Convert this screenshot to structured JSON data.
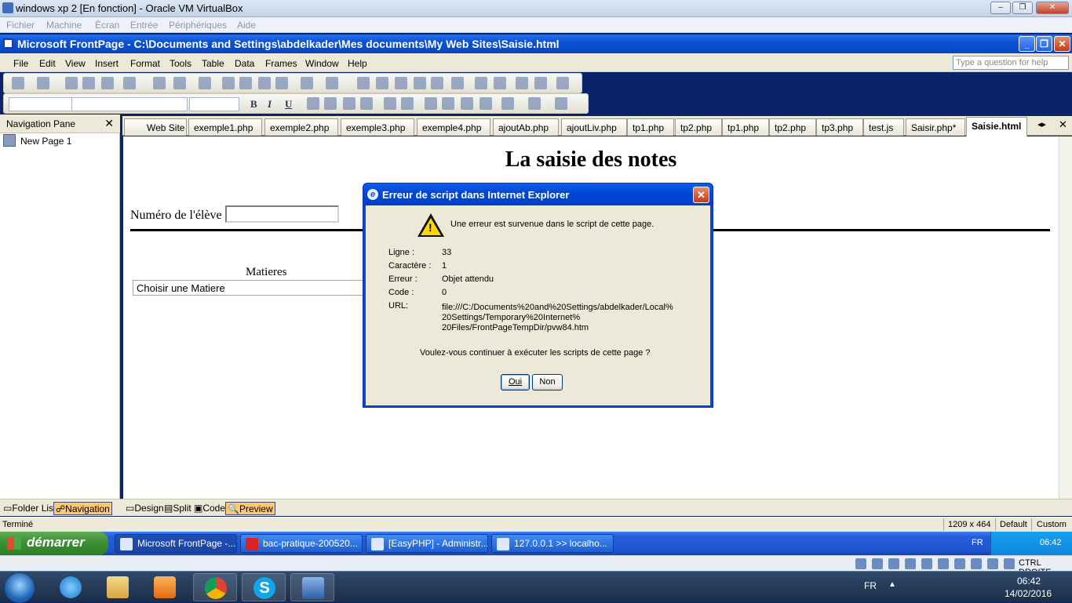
{
  "vbox": {
    "title": "windows xp 2 [En fonction] - Oracle VM VirtualBox",
    "menu": [
      "Fichier",
      "Machine",
      "Écran",
      "Entrée",
      "Périphériques",
      "Aide"
    ],
    "status_right": "CTRL DROITE"
  },
  "frontpage": {
    "title": "Microsoft FrontPage - C:\\Documents and Settings\\abdelkader\\Mes documents\\My Web Sites\\Saisie.html",
    "menu": [
      "File",
      "Edit",
      "View",
      "Insert",
      "Format",
      "Tools",
      "Table",
      "Data",
      "Frames",
      "Window",
      "Help"
    ],
    "help_placeholder": "Type a question for help",
    "nav_pane": {
      "title": "Navigation Pane",
      "close": "✕",
      "item": "New Page 1"
    },
    "tabs": [
      "Web Site",
      "exemple1.php",
      "exemple2.php",
      "exemple3.php",
      "exemple4.php",
      "ajoutAb.php",
      "ajoutLiv.php",
      "tp1.php",
      "tp2.php",
      "tp1.php",
      "tp2.php",
      "tp3.php",
      "test.js",
      "Saisir.php*",
      "Saisie.html"
    ],
    "active_tab": "Saisie.html",
    "doc": {
      "heading": "La saisie des notes",
      "num_label": "Numéro de l'élève :",
      "matieres_label": "Matieres",
      "select_value": "Choisir une Matiere"
    },
    "view_buttons": {
      "folder_list": "Folder List",
      "navigation": "Navigation",
      "design": "Design",
      "split": "Split",
      "code": "Code",
      "preview": "Preview"
    },
    "status": {
      "left": "Terminé",
      "size": "1209 x 464",
      "mode": "Default",
      "custom": "Custom"
    }
  },
  "xp_taskbar": {
    "start": "démarrer",
    "items": [
      "Microsoft FrontPage -...",
      "bac-pratique-200520...",
      "[EasyPHP] - Administr...",
      "127.0.0.1 >> localho..."
    ],
    "lang": "FR",
    "time": "06:42"
  },
  "host_taskbar": {
    "lang": "FR",
    "time": "06:42",
    "date": "14/02/2016"
  },
  "dialog": {
    "title": "Erreur de script dans Internet Explorer",
    "message": "Une erreur est survenue dans le script de cette page.",
    "fields": [
      {
        "label": "Ligne :",
        "value": "33"
      },
      {
        "label": "Caractère :",
        "value": "1"
      },
      {
        "label": "Erreur :",
        "value": "Objet attendu"
      },
      {
        "label": "Code :",
        "value": "0"
      }
    ],
    "url_label": "URL:",
    "url_lines": [
      "file:///C:/Documents%20and%20Settings/abdelkader/Local%",
      "20Settings/Temporary%20Internet%",
      "20Files/FrontPageTempDir/pvw84.htm"
    ],
    "question": "Voulez-vous continuer à exécuter les scripts de cette page ?",
    "yes": "Oui",
    "no": "Non"
  }
}
